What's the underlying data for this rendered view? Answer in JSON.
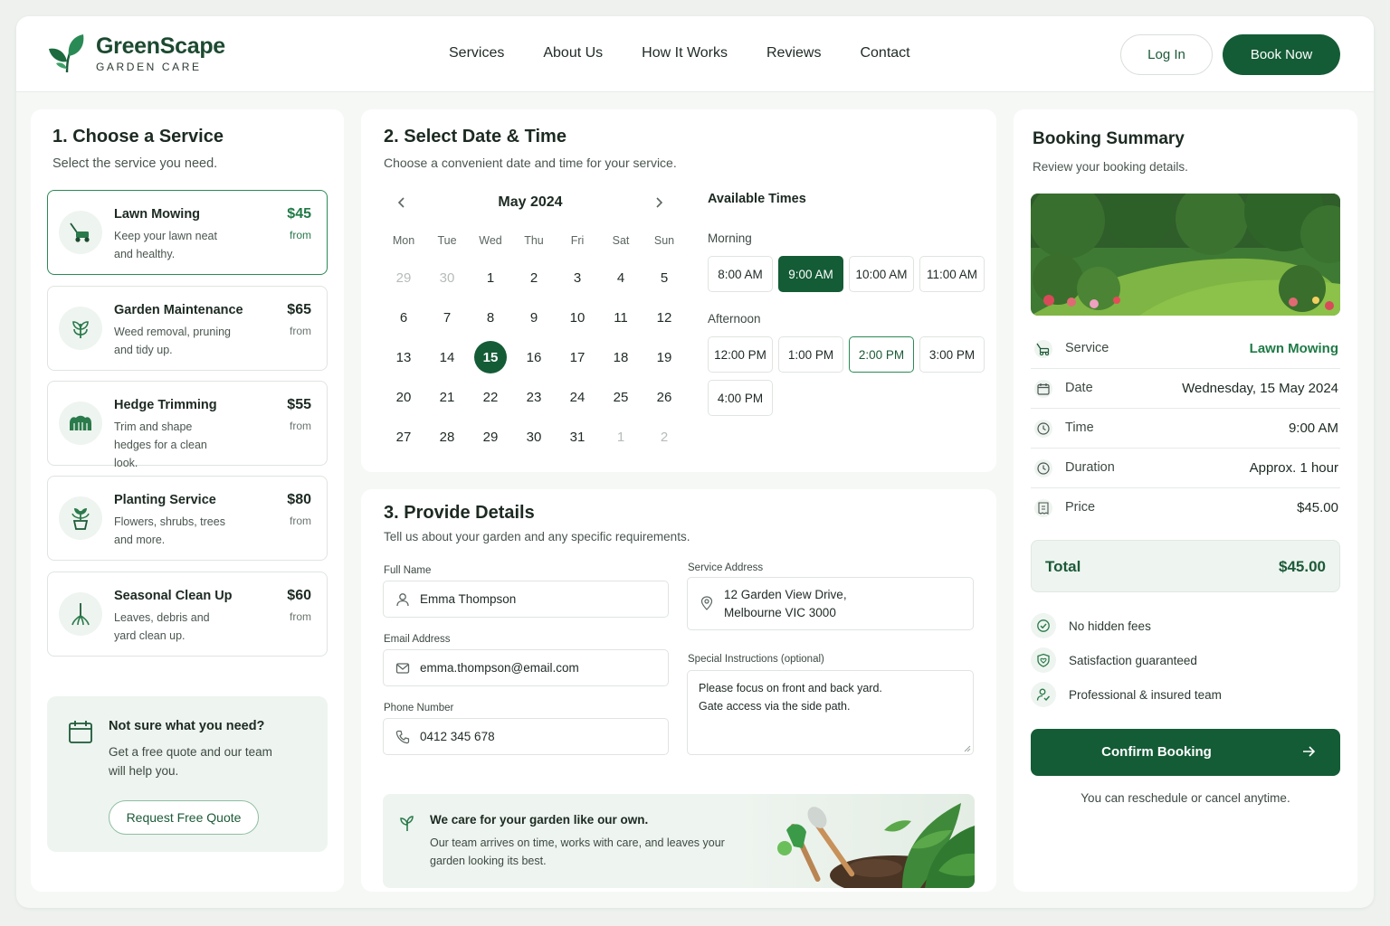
{
  "brand": {
    "name": "GreenScape",
    "tagline": "GARDEN CARE"
  },
  "nav": {
    "items": [
      "Services",
      "About Us",
      "How It Works",
      "Reviews",
      "Contact"
    ],
    "login": "Log In",
    "book": "Book Now"
  },
  "step1": {
    "title": "1. Choose a Service",
    "subtitle": "Select the service you need.",
    "services": [
      {
        "name": "Lawn Mowing",
        "desc": "Keep your lawn neat and healthy.",
        "price": "$45",
        "from": "from",
        "icon": "lawn-mower-icon",
        "selected": true
      },
      {
        "name": "Garden Maintenance",
        "desc": "Weed removal, pruning and tidy up.",
        "price": "$65",
        "from": "from",
        "icon": "plant-icon",
        "selected": false
      },
      {
        "name": "Hedge Trimming",
        "desc": "Trim and shape hedges for a clean look.",
        "price": "$55",
        "from": "from",
        "icon": "hedge-icon",
        "selected": false
      },
      {
        "name": "Planting Service",
        "desc": "Flowers, shrubs, trees and more.",
        "price": "$80",
        "from": "from",
        "icon": "potted-plant-icon",
        "selected": false
      },
      {
        "name": "Seasonal Clean Up",
        "desc": "Leaves, debris and yard clean up.",
        "price": "$60",
        "from": "from",
        "icon": "rake-icon",
        "selected": false
      }
    ],
    "quote": {
      "title": "Not sure what you need?",
      "desc": "Get a free quote and our team will help you.",
      "button": "Request Free Quote"
    }
  },
  "step2": {
    "title": "2. Select Date & Time",
    "subtitle": "Choose a convenient date and time for your service.",
    "month": "May 2024",
    "weekdays": [
      "Mon",
      "Tue",
      "Wed",
      "Thu",
      "Fri",
      "Sat",
      "Sun"
    ],
    "days": [
      "29",
      "30",
      "1",
      "2",
      "3",
      "4",
      "5",
      "6",
      "7",
      "8",
      "9",
      "10",
      "11",
      "12",
      "13",
      "14",
      "15",
      "16",
      "17",
      "18",
      "19",
      "20",
      "21",
      "22",
      "23",
      "24",
      "25",
      "26",
      "27",
      "28",
      "29",
      "30",
      "31",
      "1",
      "2"
    ],
    "muted_days": [
      0,
      1,
      33,
      34
    ],
    "selected_day": 16,
    "times_title": "Available Times",
    "morning_label": "Morning",
    "morning": [
      "8:00 AM",
      "9:00 AM",
      "10:00 AM",
      "11:00 AM"
    ],
    "afternoon_label": "Afternoon",
    "afternoon": [
      "12:00 PM",
      "1:00 PM",
      "2:00 PM",
      "3:00 PM",
      "4:00 PM"
    ],
    "selected_time": "9:00 AM",
    "highlighted_time": "2:00 PM"
  },
  "step3": {
    "title": "3. Provide Details",
    "subtitle": "Tell us about your garden and any specific requirements.",
    "full_name": {
      "label": "Full Name",
      "value": "Emma Thompson"
    },
    "email": {
      "label": "Email Address",
      "value": "emma.thompson@email.com"
    },
    "phone": {
      "label": "Phone Number",
      "value": "0412 345 678"
    },
    "address": {
      "label": "Service Address",
      "line1": "12 Garden View Drive,",
      "line2": "Melbourne VIC 3000"
    },
    "instructions": {
      "label": "Special Instructions (optional)",
      "line1": "Please focus on front and back yard.",
      "line2": "Gate access via the side path."
    },
    "banner": {
      "title": "We care for your garden like our own.",
      "desc": "Our team arrives on time, works with care, and leaves your garden looking its best."
    }
  },
  "summary": {
    "title": "Booking Summary",
    "subtitle": "Review your booking details.",
    "rows": [
      {
        "label": "Service",
        "value": "Lawn Mowing",
        "icon": "lawn-mower-icon"
      },
      {
        "label": "Date",
        "value": "Wednesday, 15 May 2024",
        "icon": "calendar-icon"
      },
      {
        "label": "Time",
        "value": "9:00 AM",
        "icon": "clock-icon"
      },
      {
        "label": "Duration",
        "value": "Approx. 1 hour",
        "icon": "clock-icon"
      },
      {
        "label": "Price",
        "value": "$45.00",
        "icon": "receipt-icon"
      }
    ],
    "total_label": "Total",
    "total_value": "$45.00",
    "perks": [
      "No hidden fees",
      "Satisfaction guaranteed",
      "Professional & insured team"
    ],
    "confirm": "Confirm Booking",
    "note": "You can reschedule or cancel anytime."
  },
  "colors": {
    "primary": "#145c36",
    "accent": "#1f7a46",
    "tint": "#eef4ef"
  }
}
